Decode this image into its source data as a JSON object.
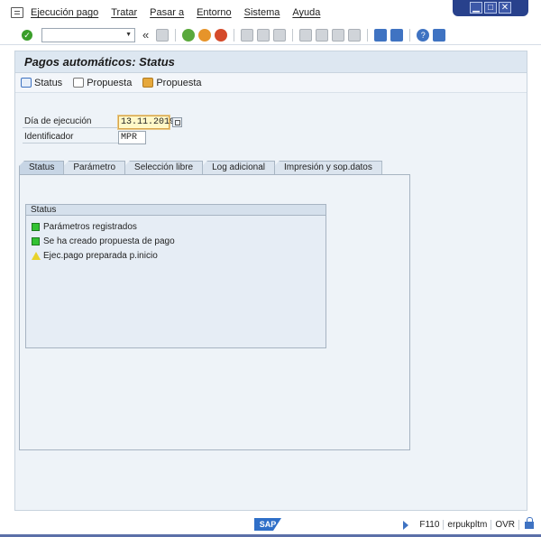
{
  "menubar": {
    "items": [
      "Ejecución pago",
      "Tratar",
      "Pasar a",
      "Entorno",
      "Sistema",
      "Ayuda"
    ]
  },
  "window_controls": {
    "minimize": "▁",
    "maximize": "□",
    "close": "✕"
  },
  "toolbar": {
    "command_field_value": "",
    "back_glyph": "«"
  },
  "screen": {
    "title": "Pagos automáticos: Status",
    "app_toolbar": [
      {
        "label": "Status",
        "icon": "status-icon"
      },
      {
        "label": "Propuesta",
        "icon": "proposal-edit-icon"
      },
      {
        "label": "Propuesta",
        "icon": "proposal-icon"
      }
    ],
    "fields": {
      "run_date_label": "Día de ejecución",
      "run_date_value": "13.11.2019",
      "identifier_label": "Identificador",
      "identifier_value": "MPR"
    },
    "tabs": [
      "Status",
      "Parámetro",
      "Selección libre",
      "Log adicional",
      "Impresión y sop.datos"
    ],
    "active_tab": "Status",
    "status_group": {
      "title": "Status",
      "lines": [
        {
          "text": "Parámetros registrados",
          "state": "green"
        },
        {
          "text": "Se ha creado propuesta de pago",
          "state": "green"
        },
        {
          "text": "Ejec.pago preparada p.inicio",
          "state": "yellow"
        }
      ]
    }
  },
  "statusbar": {
    "logo": "SAP",
    "transaction": "F110",
    "server": "erpukpltm",
    "mode": "OVR"
  },
  "colors": {
    "accent": "#3f73c2",
    "status_green": "#33c233",
    "status_yellow": "#e8d22a"
  }
}
